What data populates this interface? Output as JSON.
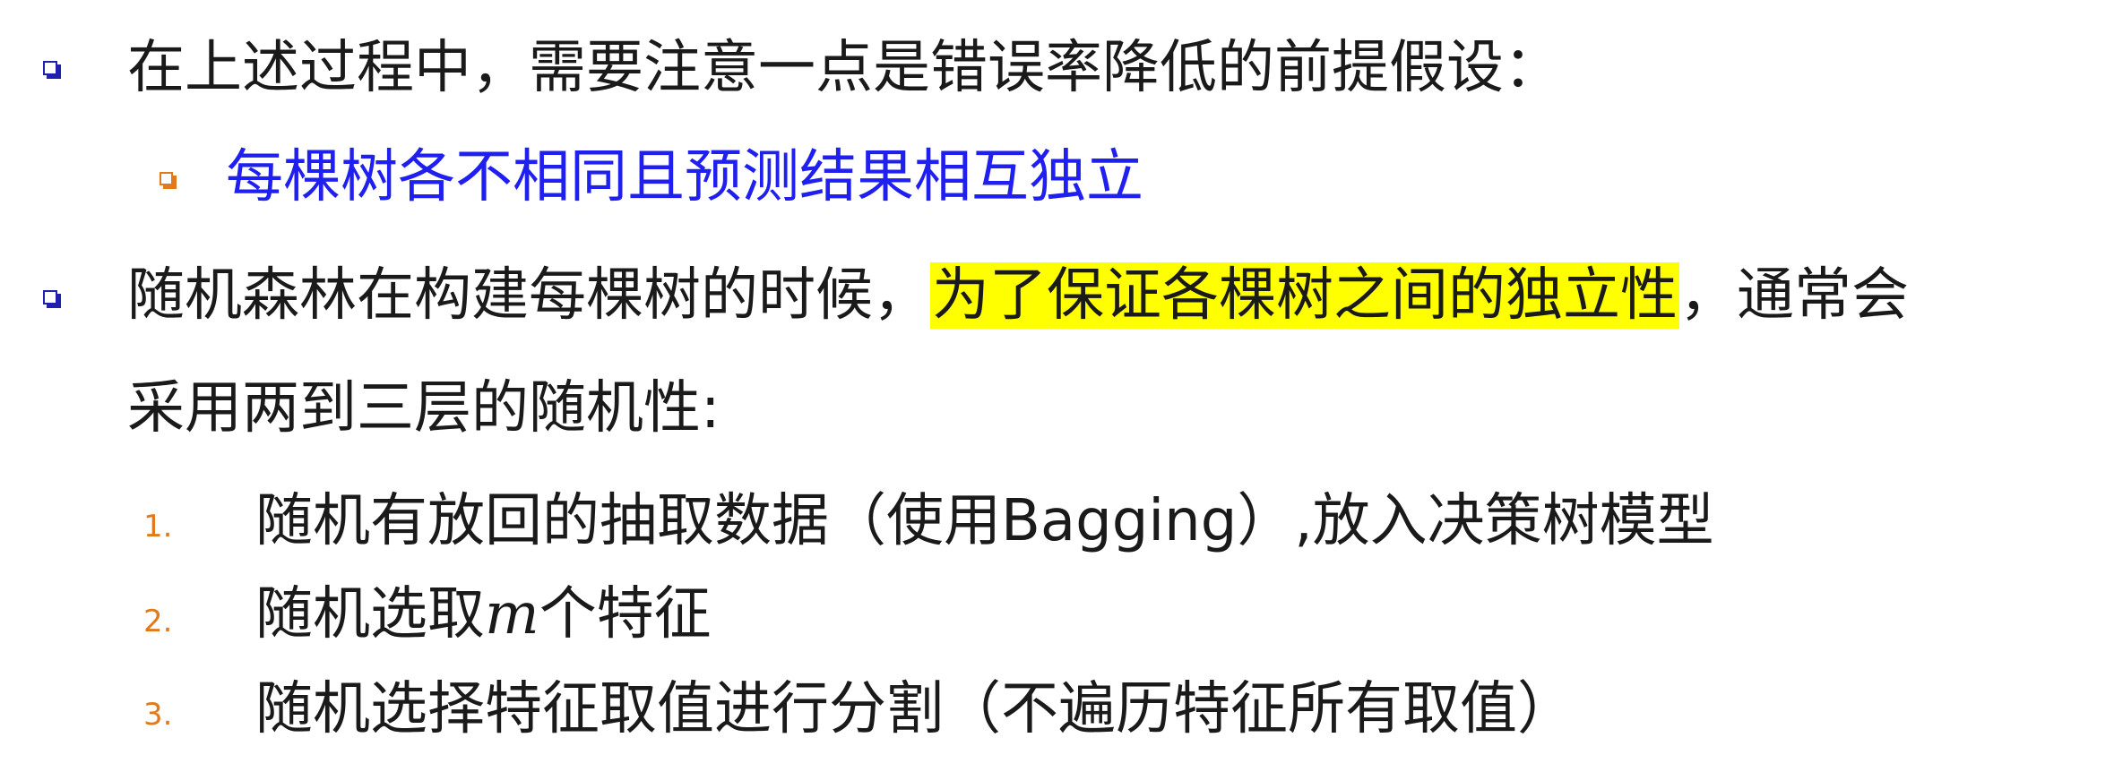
{
  "bullets": [
    {
      "text": "在上述过程中，需要注意一点是错误率降低的前提假设："
    },
    {
      "text": "每棵树各不相同且预测结果相互独立"
    },
    {
      "text_before": "随机森林在构建每棵树的时候，",
      "highlight": "为了保证各棵树之间的独立性",
      "text_after": "，通常会",
      "continuation": "采用两到三层的随机性:"
    }
  ],
  "numbered": [
    {
      "number": "1.",
      "text": "随机有放回的抽取数据（使用Bagging）,放入决策树模型"
    },
    {
      "number": "2.",
      "text_before": "随机选取",
      "math": "m",
      "text_after": "个特征"
    },
    {
      "number": "3.",
      "text": "随机选择特征取值进行分割（不遍历特征所有取值）"
    }
  ],
  "colors": {
    "bullet_primary": "#1f1fb0",
    "bullet_secondary": "#e07a1a",
    "sub_text": "#1f1ff0",
    "highlight": "#ffff00",
    "numbers": "#e07a1a"
  }
}
